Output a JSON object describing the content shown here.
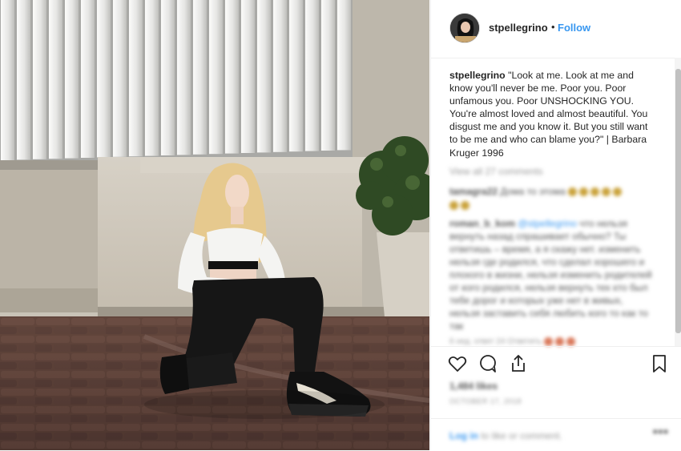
{
  "post": {
    "username": "stpellegrino",
    "separator": "•",
    "follow_label": "Follow",
    "caption_user": "stpellegrino",
    "caption_text": " \"Look at me. Look at me and know you'll never be me. Poor you. Poor unfamous you. Poor UNSHOCKING YOU. You're almost loved and almost beautiful. You disgust me and you know it. But you still want to be me and who can blame you?\" | Barbara Kruger 1996"
  },
  "comments": {
    "view_all": "View all 27 comments",
    "c1_user": "tamagra22",
    "c1_text": " Дома то этома",
    "c2_user": "roman_b_kom",
    "c2_mention": " @stpellegrino",
    "c2_text": " что нельзя вернуть назад спрашивает обычно? Ты ответишь – время, а я скажу нет. изменить нельзя где родился, что сделал хорошего и плохого в жизни, нельзя изменить родителей от кого родился, нельзя вернуть тех кто был тебе дорог и которых уже нет в живых, нельзя заставить себя любить кого то как то так",
    "c3_text": "6 нед. ответ 24 Ответить"
  },
  "stats": {
    "likes": "1,484 likes",
    "date": "OCTOBER 17, 2018"
  },
  "footer": {
    "login_link": "Log in",
    "login_rest": " to like or comment.",
    "more": "•••"
  },
  "icons": {
    "like": "heart-icon",
    "comment": "comment-icon",
    "share": "share-icon",
    "save": "bookmark-icon",
    "more": "more-options-icon"
  },
  "colors": {
    "accent": "#3897f0",
    "text": "#262626",
    "muted": "#999999",
    "border": "#efefef"
  }
}
